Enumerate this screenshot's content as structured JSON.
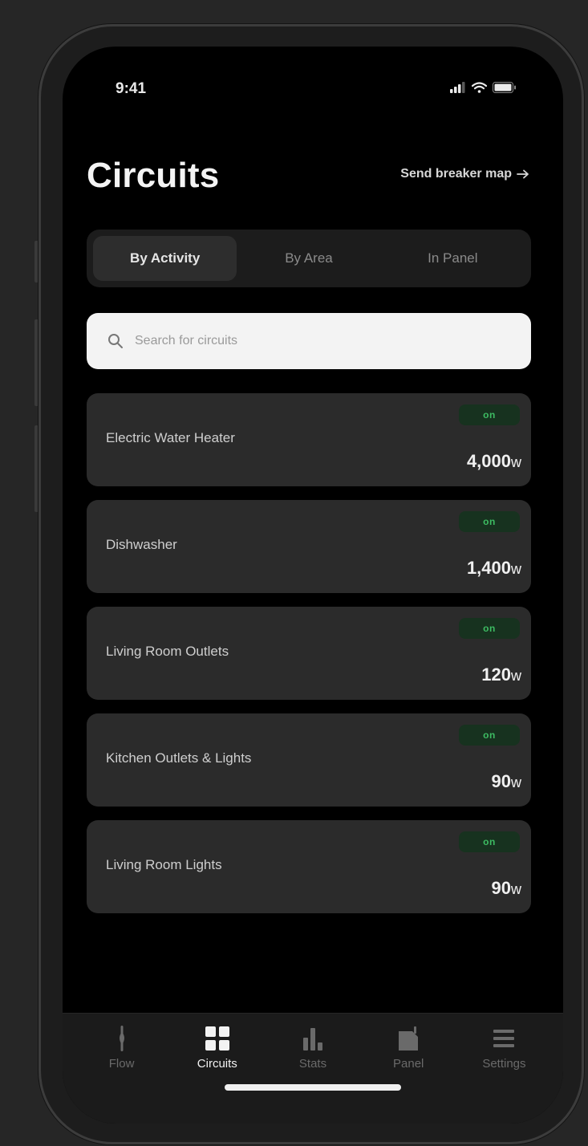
{
  "status_bar": {
    "time": "9:41"
  },
  "header": {
    "title": "Circuits",
    "action_label": "Send breaker map",
    "action_icon": "arrow-right-icon"
  },
  "view_tabs": [
    {
      "label": "By Activity",
      "active": true
    },
    {
      "label": "By Area",
      "active": false
    },
    {
      "label": "In Panel",
      "active": false
    }
  ],
  "search": {
    "placeholder": "Search for circuits",
    "value": ""
  },
  "circuits": [
    {
      "name": "Electric Water Heater",
      "status": "on",
      "watts": "4,000",
      "unit": "w"
    },
    {
      "name": "Dishwasher",
      "status": "on",
      "watts": "1,400",
      "unit": "w"
    },
    {
      "name": "Living Room Outlets",
      "status": "on",
      "watts": "120",
      "unit": "w"
    },
    {
      "name": "Kitchen Outlets & Lights",
      "status": "on",
      "watts": "90",
      "unit": "w"
    },
    {
      "name": "Living Room Lights",
      "status": "on",
      "watts": "90",
      "unit": "w"
    }
  ],
  "bottom_nav": [
    {
      "label": "Flow",
      "icon": "flow-icon",
      "active": false
    },
    {
      "label": "Circuits",
      "icon": "circuits-grid-icon",
      "active": true
    },
    {
      "label": "Stats",
      "icon": "bar-chart-icon",
      "active": false
    },
    {
      "label": "Panel",
      "icon": "panel-icon",
      "active": false
    },
    {
      "label": "Settings",
      "icon": "menu-icon",
      "active": false
    }
  ],
  "colors": {
    "background": "#000000",
    "card": "#2b2b2b",
    "badge_bg": "#17321f",
    "badge_text": "#3dbb62",
    "active_text": "#f2f2f2",
    "inactive_text": "#6a6a6a"
  }
}
